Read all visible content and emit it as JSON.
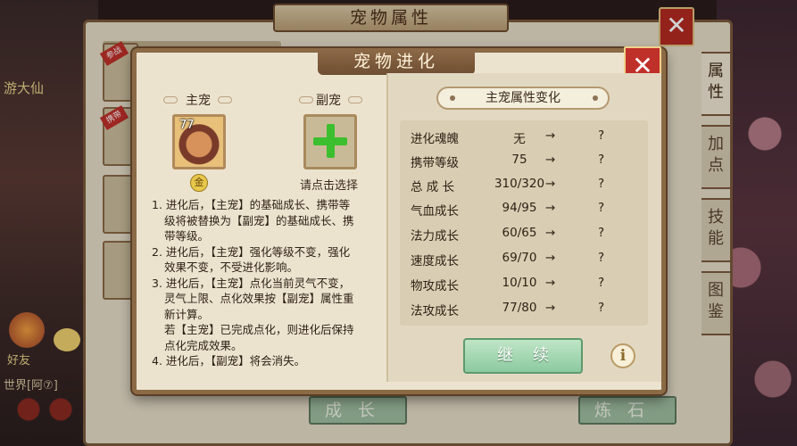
{
  "background": {
    "left_name": "游大仙",
    "left_friends": "好友",
    "left_world": "世界[阿⑦]",
    "back_title": "宠物属性",
    "side_tabs": [
      "属性",
      "加点",
      "技能",
      "图鉴"
    ],
    "back_buttons": [
      "成长",
      "炼石"
    ],
    "badges": [
      "参战",
      "携带"
    ]
  },
  "dialog": {
    "title": "宠物进化",
    "main_pet_label": "主宠",
    "sub_pet_label": "副宠",
    "main_pet_level": "77",
    "main_pet_grade": "金",
    "sub_pet_hint": "请点击选择",
    "rules": [
      "1. 进化后，【主宠】的基础成长、携带等",
      "级将被替换为【副宠】的基础成长、携",
      "带等级。",
      "2. 进化后，【主宠】强化等级不变，强化",
      "效果不变，不受进化影响。",
      "3. 进化后，【主宠】点化当前灵气不变，",
      "灵气上限、点化效果按【副宠】属性重",
      "新计算。",
      "若【主宠】已完成点化，则进化后保持",
      "点化完成效果。",
      "4. 进化后，【副宠】将会消失。"
    ],
    "attr_header": "主宠属性变化",
    "attrs": [
      {
        "name": "进化魂魄",
        "value": "无",
        "arrow": "→",
        "new": "?"
      },
      {
        "name": "携带等级",
        "value": "75",
        "arrow": "→",
        "new": "?"
      },
      {
        "name": "总 成 长",
        "value": "310/320",
        "arrow": "→",
        "new": "?"
      },
      {
        "name": "气血成长",
        "value": "94/95",
        "arrow": "→",
        "new": "?"
      },
      {
        "name": "法力成长",
        "value": "60/65",
        "arrow": "→",
        "new": "?"
      },
      {
        "name": "速度成长",
        "value": "69/70",
        "arrow": "→",
        "new": "?"
      },
      {
        "name": "物攻成长",
        "value": "10/10",
        "arrow": "→",
        "new": "?"
      },
      {
        "name": "法攻成长",
        "value": "77/80",
        "arrow": "→",
        "new": "?"
      }
    ],
    "continue_label": "继续",
    "info_label": "i",
    "close_label": "✕"
  },
  "colors": {
    "accent_green": "#3cbf2e",
    "close_red": "#c0302a",
    "panel_bg": "#ece3cf"
  }
}
